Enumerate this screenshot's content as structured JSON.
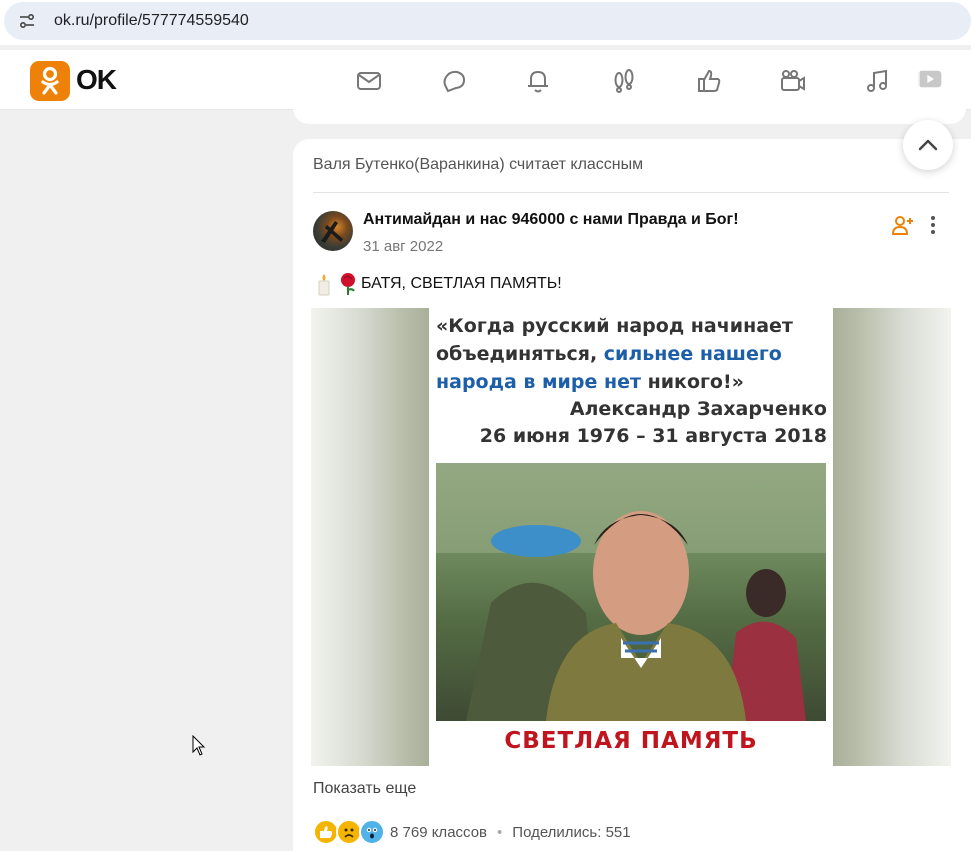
{
  "browser": {
    "url": "ok.ru/profile/577774559540",
    "site_info_icon": "tune-icon"
  },
  "header": {
    "logo_text": "OK",
    "brand_color": "#ee8208",
    "nav_icons": [
      "messages-icon",
      "discussions-icon",
      "notifications-icon",
      "guests-icon",
      "marks-icon",
      "video-calls-icon",
      "music-icon",
      "video-icon"
    ]
  },
  "post": {
    "liked_by": "Валя Бутенко(Варанкина) считает классным",
    "group_name": "Антимайдан и нас 946000 с нами Правда и Бог!",
    "date": "31 авг 2022",
    "text": "БАТЯ, СВЕТЛАЯ ПАМЯТЬ!",
    "text_emojis": [
      "candle-icon",
      "rose-icon"
    ],
    "image": {
      "quote_part1": "«Когда русский народ начинает объединяться, ",
      "quote_highlight": "сильнее нашего народа в мире нет",
      "quote_part2": " никого!»",
      "author_name": "Александр Захарченко",
      "author_dates": "26 июня 1976 – 31 августа 2018",
      "caption": "СВЕТЛАЯ ПАМЯТЬ"
    },
    "show_more": "Показать еще",
    "reactions": {
      "icons": [
        "like-icon",
        "sad-icon",
        "shock-icon"
      ],
      "count_text": "8 769 классов",
      "separator": "•",
      "shares_text": "Поделились: 551"
    }
  }
}
